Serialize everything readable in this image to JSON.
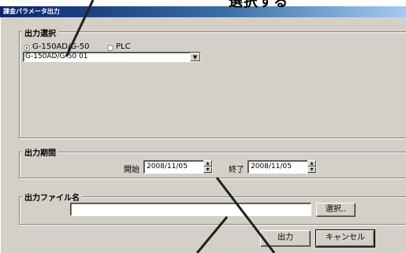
{
  "caption": "選択する",
  "window": {
    "title": "課金パラメータ出力"
  },
  "output_select": {
    "legend": "出力選択",
    "radio_g150": "G-150AD/G-50",
    "radio_plc": "PLC",
    "selected": "G-150AD/G-50",
    "dropdown_value": "G-150AD/G-50 01"
  },
  "output_period": {
    "legend": "出力期間",
    "start_label": "開始",
    "start_value": "2008/11/05",
    "end_label": "終了",
    "end_value": "2008/11/05"
  },
  "output_file": {
    "legend": "出力ファイル名",
    "value": "",
    "select_button": "選択.."
  },
  "buttons": {
    "output": "出力",
    "cancel": "キャンセル"
  },
  "colors": {
    "face": "#d4d0c8",
    "title_start": "#0a246a",
    "title_end": "#a6caf0"
  }
}
